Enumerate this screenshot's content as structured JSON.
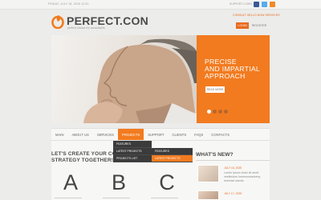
{
  "topbar": {
    "date": "FRIDAY, JULY 18, 2025 12:00",
    "links": "SUPPORT   LOGIN",
    "social": [
      {
        "icon": "facebook-icon",
        "color": "#3b5998"
      },
      {
        "icon": "twitter-icon",
        "color": "#55acee"
      },
      {
        "icon": "rss-icon",
        "color": "#f0892b"
      }
    ]
  },
  "header": {
    "logo": "PERFECT.CON",
    "tagline": "perfect choice for consultants",
    "contact_link": "CONSULT HELLO NOW SERVICES",
    "login": "LOGIN",
    "register": "REGISTER"
  },
  "hero": {
    "headline": "PRECISE\nAND IMPARTIAL\nAPPROACH",
    "button": "READ MORE",
    "slides": 4,
    "active_slide": 1
  },
  "nav": {
    "items": [
      "MAIN",
      "ABOUT US",
      "SERVICES",
      "PROJECTS",
      "SUPPORT",
      "CLIENTS",
      "FAQS",
      "CONTACTS"
    ],
    "active": "PROJECTS"
  },
  "dropdown": {
    "level1": [
      "FEATURES",
      "LATEST PROJECTS",
      "PROJECTS LIST"
    ],
    "level2": [
      "FEATURES",
      "LATEST PROJECTS"
    ]
  },
  "content": {
    "heading": "LET'S CREATE YOUR CO\nSTRATEGY TOGETHER!",
    "letters": [
      "A",
      "B",
      "C"
    ]
  },
  "news": {
    "title": "WHAT'S NEW?",
    "items": [
      {
        "date": "JULY 18, 2025",
        "text": "Lorem ipsum dolor sit amet vestibulum loremusmaxiumy loremiat mauris"
      },
      {
        "date": "JULY 17, 2025"
      }
    ]
  },
  "colors": {
    "accent": "#f27b1f",
    "dark_menu": "#3b3b3b",
    "background": "#ececea"
  }
}
